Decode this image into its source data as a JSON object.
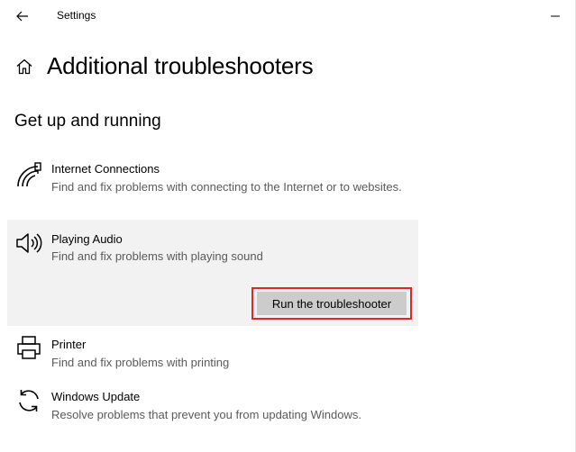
{
  "window": {
    "title": "Settings",
    "minimize_icon": "minimize-icon",
    "close_icon": "close-icon",
    "back_icon": "back-arrow-icon"
  },
  "page": {
    "title": "Additional troubleshooters",
    "home_icon": "home-icon"
  },
  "section": {
    "title": "Get up and running"
  },
  "items": [
    {
      "name": "Internet Connections",
      "description": "Find and fix problems with connecting to the Internet or to websites.",
      "icon": "network-icon"
    },
    {
      "name": "Playing Audio",
      "description": "Find and fix problems with playing sound",
      "icon": "speaker-icon",
      "selected": true,
      "action_label": "Run the troubleshooter"
    },
    {
      "name": "Printer",
      "description": "Find and fix problems with printing",
      "icon": "printer-icon"
    },
    {
      "name": "Windows Update",
      "description": "Resolve problems that prevent you from updating Windows.",
      "icon": "sync-icon"
    }
  ],
  "colors": {
    "highlight_border": "#e3242b",
    "selected_background": "#f2f2f2",
    "button_background": "#cccccc",
    "description_text": "#5a5a5a"
  }
}
